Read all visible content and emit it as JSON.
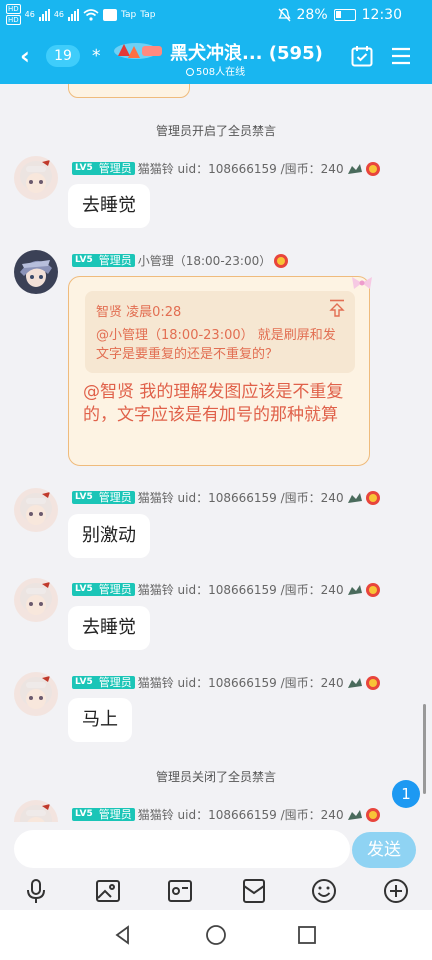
{
  "status_bar": {
    "sim1": "HD",
    "sim2": "HD",
    "net1": "46",
    "net2": "46",
    "app_text_1": "Tap",
    "app_text_2": "Tap",
    "battery": "28%",
    "time": "12:30"
  },
  "header": {
    "unread_count": "19",
    "title": "黑犬冲浪...",
    "member_count": "(595)",
    "online": "508人在线"
  },
  "messages": {
    "system_mute_on": "管理员开启了全员禁言",
    "system_mute_off": "管理员关闭了全员禁言",
    "level_badge": "LV5",
    "role_badge": "管理员",
    "cat_meta": "猫猫铃 uid：108666159 /囤币：240",
    "small_admin_meta": "小管理（18:00-23:00）",
    "msg1": "去睡觉",
    "quote_author": "智贤 凌晨0:28",
    "quote_text": "@小管理（18:00-23:00） 就是刷屏和发文字是要重复的还是不重复的？",
    "reply_text": "@智贤 我的理解发图应该是不重复的，文字应该是有加号的那种就算",
    "msg3": "别激动",
    "msg4": "去睡觉",
    "msg5": "马上"
  },
  "new_message_count": "1",
  "input": {
    "send_label": "发送"
  },
  "toolbar_icons": [
    "microphone-icon",
    "image-icon",
    "video-icon",
    "red-envelope-icon",
    "emoji-icon",
    "plus-icon"
  ],
  "nav_icons": [
    "back-icon",
    "home-icon",
    "recent-apps-icon"
  ],
  "colors": {
    "header_bg": "#19b6f0",
    "badge_bg": "#1bc5b7",
    "card_bg": "#fdf3e3",
    "card_border": "#efbb7c",
    "reply_text": "#e0614a",
    "send_bg": "#8fd3f3",
    "unread_bubble": "#1d99f2"
  }
}
